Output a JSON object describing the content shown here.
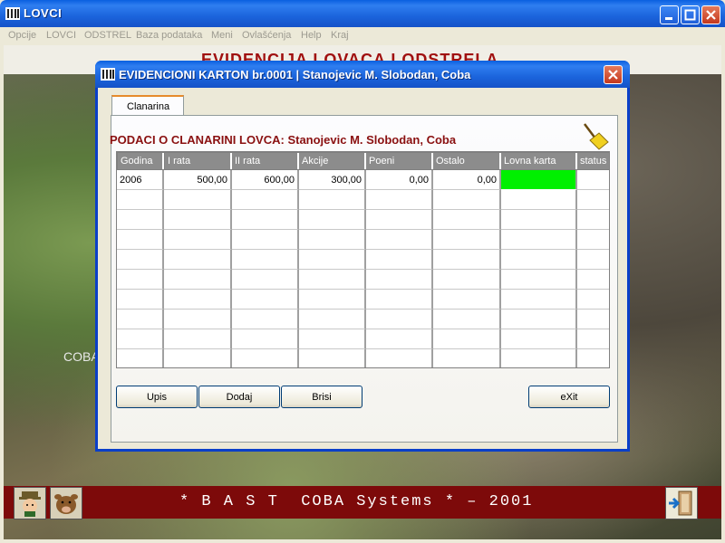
{
  "app": {
    "title": "LOVCI"
  },
  "menu": [
    "Opcije",
    "LOVCI",
    "ODSTREL",
    "Baza podataka",
    "Meni",
    "Ovlašćenja",
    "Help",
    "Kraj"
  ],
  "background": {
    "heading": "EVIDENCIJA LOVACA I ODSTRELA",
    "coba_label": "COBA",
    "banner": "* B A S T  COBA Systems * – 2001"
  },
  "dialog": {
    "title": "EVIDENCIONI KARTON br.0001 | Stanojevic M. Slobodan, Coba",
    "tab": "Clanarina",
    "section_title": "PODACI O CLANARINI LOVCA: Stanojevic M. Slobodan, Coba",
    "columns": [
      "Godina",
      "I rata",
      "II rata",
      "Akcije",
      "Poeni",
      "Ostalo",
      "Lovna karta",
      "status"
    ],
    "rows": [
      {
        "godina": "2006",
        "i_rata": "500,00",
        "ii_rata": "600,00",
        "akcije": "300,00",
        "poeni": "0,00",
        "ostalo": "0,00",
        "lovna_karta": "",
        "status": ""
      }
    ],
    "lovna_karta_color": "#00f000",
    "buttons": {
      "upis": "Upis",
      "dodaj": "Dodaj",
      "brisi": "Brisi",
      "exit": "eXit"
    }
  },
  "colors": {
    "title_bar": "#1b64dc",
    "banner": "#7d0a0a",
    "section_title": "#8a1010"
  }
}
